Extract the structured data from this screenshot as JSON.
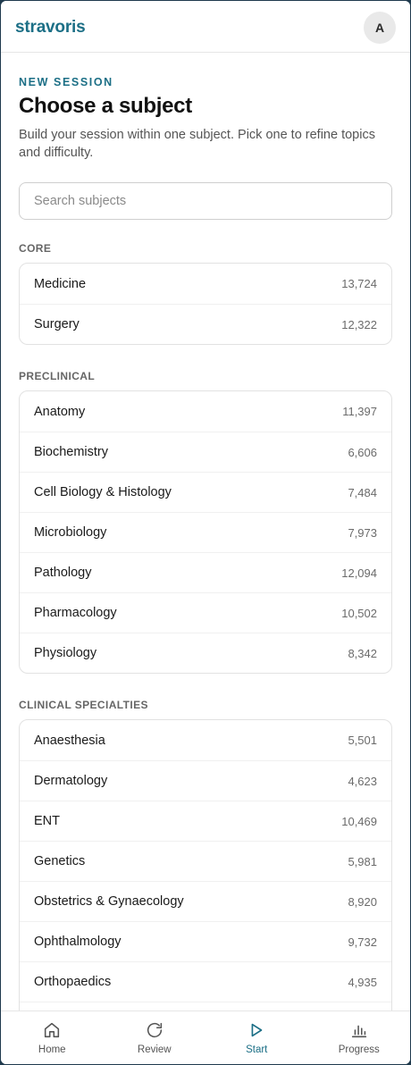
{
  "header": {
    "brand": "stravoris",
    "avatar_initial": "A"
  },
  "page": {
    "eyebrow": "NEW SESSION",
    "title": "Choose a subject",
    "subtitle": "Build your session within one subject. Pick one to refine topics and difficulty."
  },
  "search": {
    "placeholder": "Search subjects",
    "value": ""
  },
  "sections": [
    {
      "label": "CORE",
      "items": [
        {
          "name": "Medicine",
          "count": "13,724"
        },
        {
          "name": "Surgery",
          "count": "12,322"
        }
      ]
    },
    {
      "label": "PRECLINICAL",
      "items": [
        {
          "name": "Anatomy",
          "count": "11,397"
        },
        {
          "name": "Biochemistry",
          "count": "6,606"
        },
        {
          "name": "Cell Biology & Histology",
          "count": "7,484"
        },
        {
          "name": "Microbiology",
          "count": "7,973"
        },
        {
          "name": "Pathology",
          "count": "12,094"
        },
        {
          "name": "Pharmacology",
          "count": "10,502"
        },
        {
          "name": "Physiology",
          "count": "8,342"
        }
      ]
    },
    {
      "label": "CLINICAL SPECIALTIES",
      "items": [
        {
          "name": "Anaesthesia",
          "count": "5,501"
        },
        {
          "name": "Dermatology",
          "count": "4,623"
        },
        {
          "name": "ENT",
          "count": "10,469"
        },
        {
          "name": "Genetics",
          "count": "5,981"
        },
        {
          "name": "Obstetrics & Gynaecology",
          "count": "8,920"
        },
        {
          "name": "Ophthalmology",
          "count": "9,732"
        },
        {
          "name": "Orthopaedics",
          "count": "4,935"
        }
      ]
    }
  ],
  "nav": [
    {
      "label": "Home",
      "icon": "home-icon",
      "active": false
    },
    {
      "label": "Review",
      "icon": "refresh-icon",
      "active": false
    },
    {
      "label": "Start",
      "icon": "play-icon",
      "active": true
    },
    {
      "label": "Progress",
      "icon": "bar-chart-icon",
      "active": false
    }
  ],
  "colors": {
    "accent": "#1c6f86",
    "frame": "#1f3a4d"
  }
}
